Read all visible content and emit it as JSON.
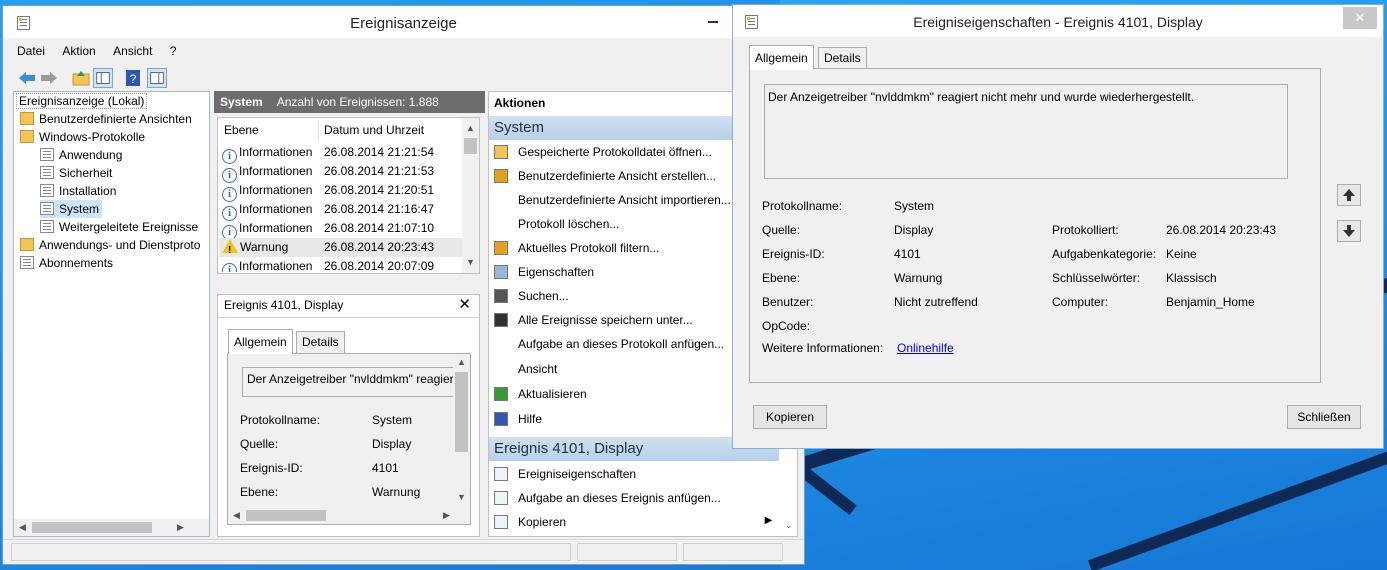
{
  "main_window": {
    "title": "Ereignisanzeige",
    "menu": [
      "Datei",
      "Aktion",
      "Ansicht",
      "?"
    ],
    "tree": {
      "root": "Ereignisanzeige (Lokal)",
      "custom_views": "Benutzerdefinierte Ansichten",
      "windows_logs": "Windows-Protokolle",
      "logs": [
        "Anwendung",
        "Sicherheit",
        "Installation",
        "System",
        "Weitergeleitete Ereignisse"
      ],
      "app_services": "Anwendungs- und Dienstproto",
      "subscriptions": "Abonnements"
    },
    "log_header": {
      "name": "System",
      "count_label": "Anzahl von Ereignissen: 1.888"
    },
    "columns": [
      "Ebene",
      "Datum und Uhrzeit"
    ],
    "rows": [
      {
        "level": "Informationen",
        "date": "26.08.2014 21:21:54",
        "icon": "info-icon"
      },
      {
        "level": "Informationen",
        "date": "26.08.2014 21:21:53",
        "icon": "info-icon"
      },
      {
        "level": "Informationen",
        "date": "26.08.2014 21:20:51",
        "icon": "info-icon"
      },
      {
        "level": "Informationen",
        "date": "26.08.2014 21:16:47",
        "icon": "info-icon"
      },
      {
        "level": "Informationen",
        "date": "26.08.2014 21:07:10",
        "icon": "info-icon"
      },
      {
        "level": "Warnung",
        "date": "26.08.2014 20:23:43",
        "icon": "warning-icon"
      },
      {
        "level": "Informationen",
        "date": "26.08.2014 20:07:09",
        "icon": "info-icon"
      }
    ],
    "preview": {
      "title": "Ereignis 4101, Display",
      "tabs": [
        "Allgemein",
        "Details"
      ],
      "message": "Der Anzeigetreiber \"nvlddmkm\" reagier",
      "fields": [
        {
          "label": "Protokollname:",
          "value": "System"
        },
        {
          "label": "Quelle:",
          "value": "Display"
        },
        {
          "label": "Ereignis-ID:",
          "value": "4101"
        },
        {
          "label": "Ebene:",
          "value": "Warnung"
        }
      ]
    },
    "actions": {
      "header": "Aktionen",
      "group_system": "System",
      "system_items": [
        "Gespeicherte Protokolldatei öffnen...",
        "Benutzerdefinierte Ansicht erstellen...",
        "Benutzerdefinierte Ansicht importieren...",
        "Protokoll löschen...",
        "Aktuelles Protokoll filtern...",
        "Eigenschaften",
        "Suchen...",
        "Alle Ereignisse speichern unter...",
        "Aufgabe an dieses Protokoll anfügen...",
        "Ansicht",
        "Aktualisieren",
        "Hilfe"
      ],
      "group_event": "Ereignis 4101, Display",
      "event_items": [
        "Ereigniseigenschaften",
        "Aufgabe an dieses Ereignis anfügen...",
        "Kopieren"
      ]
    }
  },
  "dialog": {
    "title": "Ereigniseigenschaften - Ereignis 4101, Display",
    "tabs": [
      "Allgemein",
      "Details"
    ],
    "message": "Der Anzeigetreiber \"nvlddmkm\" reagiert nicht mehr und wurde wiederhergestellt.",
    "left_fields": [
      {
        "label": "Protokollname:",
        "value": "System"
      },
      {
        "label": "Quelle:",
        "value": "Display"
      },
      {
        "label": "Ereignis-ID:",
        "value": "4101"
      },
      {
        "label": "Ebene:",
        "value": "Warnung"
      },
      {
        "label": "Benutzer:",
        "value": "Nicht zutreffend"
      },
      {
        "label": "OpCode:",
        "value": ""
      }
    ],
    "right_fields": [
      {
        "label": "Protokolliert:",
        "value": "26.08.2014 20:23:43"
      },
      {
        "label": "Aufgabenkategorie:",
        "value": "Keine"
      },
      {
        "label": "Schlüsselwörter:",
        "value": "Klassisch"
      },
      {
        "label": "Computer:",
        "value": "Benjamin_Home"
      }
    ],
    "more_info_label": "Weitere Informationen:",
    "more_info_link": "Onlinehilfe",
    "copy_button": "Kopieren",
    "close_button": "Schließen"
  }
}
